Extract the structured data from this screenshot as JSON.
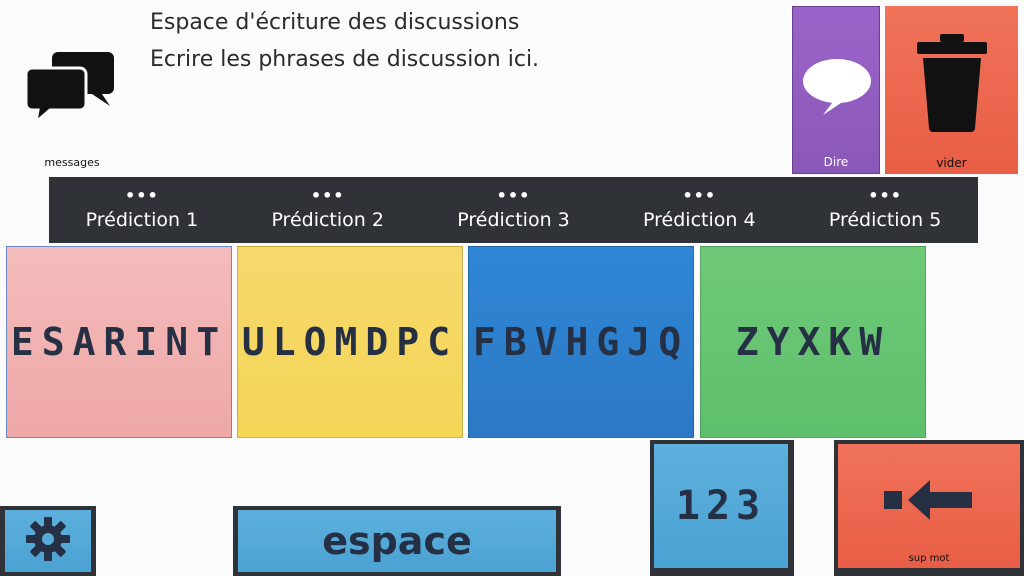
{
  "messages": {
    "label": "messages",
    "lines": [
      "Espace d'écriture des discussions",
      "Ecrire les phrases de discussion ici."
    ]
  },
  "actions": {
    "say_label": "Dire",
    "clear_label": "vider"
  },
  "predictions": [
    {
      "dots": "•••",
      "label": "Prédiction 1"
    },
    {
      "dots": "•••",
      "label": "Prédiction 2"
    },
    {
      "dots": "•••",
      "label": "Prédiction 3"
    },
    {
      "dots": "•••",
      "label": "Prédiction 4"
    },
    {
      "dots": "•••",
      "label": "Prédiction 5"
    }
  ],
  "letter_keys": [
    "ESARINT",
    "ULOMDPC",
    "FBVHGJQ",
    "ZYXKW"
  ],
  "controls": {
    "numbers_label": "123",
    "delete_word_label": "sup mot",
    "space_label": "espace"
  },
  "colors": {
    "purple": "#9b63c9",
    "red": "#e85d45",
    "pink": "#f4bcbc",
    "yellow": "#f5d860",
    "blue": "#2b80ce",
    "green": "#66c472",
    "light_blue": "#52a8d8",
    "dark_bar": "#2f3236"
  }
}
